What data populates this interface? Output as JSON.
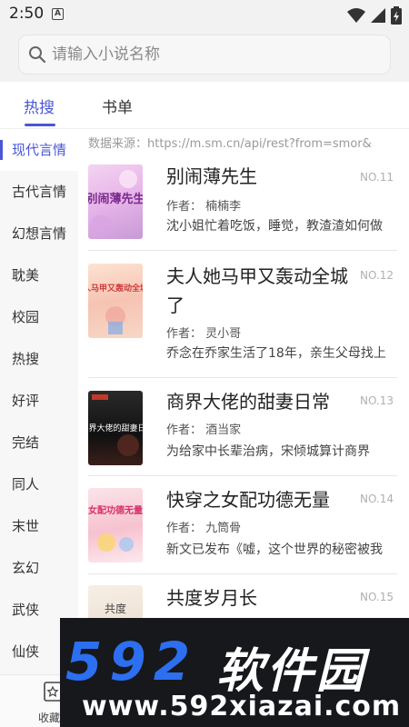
{
  "status_bar": {
    "time": "2:50",
    "notification_letter": "A"
  },
  "search": {
    "placeholder": "请输入小说名称",
    "value": ""
  },
  "tabs": [
    {
      "label": "热搜",
      "active": true
    },
    {
      "label": "书单",
      "active": false
    }
  ],
  "sidebar": {
    "items": [
      {
        "label": "现代言情",
        "active": true
      },
      {
        "label": "古代言情"
      },
      {
        "label": "幻想言情"
      },
      {
        "label": "耽美"
      },
      {
        "label": "校园"
      },
      {
        "label": "热搜"
      },
      {
        "label": "好评"
      },
      {
        "label": "完结"
      },
      {
        "label": "同人"
      },
      {
        "label": "末世"
      },
      {
        "label": "玄幻"
      },
      {
        "label": "武侠"
      },
      {
        "label": "仙侠"
      }
    ]
  },
  "source_line": "数据来源：https://m.sm.cn/api/rest?from=smor&",
  "books": [
    {
      "title": "别闹薄先生",
      "no": "NO.11",
      "author": "作者：  楠楠李",
      "desc": "沈小姐忙着吃饭，睡觉，教渣渣如何做",
      "cover_text": "别闹薄先生"
    },
    {
      "title": "夫人她马甲又轰动全城了",
      "no": "NO.12",
      "author": "作者：  灵小哥",
      "desc": "乔念在乔家生活了18年，亲生父母找上",
      "cover_text": "夫人马甲又轰动全城了"
    },
    {
      "title": "商界大佬的甜妻日常",
      "no": "NO.13",
      "author": "作者：  酒当家",
      "desc": "  为给家中长辈治病，宋倾城算计商界",
      "cover_text": "商界大佬的甜妻日常"
    },
    {
      "title": "快穿之女配功德无量",
      "no": "NO.14",
      "author": "作者：  九筒骨",
      "desc": "新文已发布《嘘，这个世界的秘密被我",
      "cover_text": "女配功德无量"
    },
    {
      "title": "共度岁月长",
      "no": "NO.15",
      "author": "",
      "desc": "",
      "cover_text": "共度"
    }
  ],
  "bottom_nav": {
    "fav_label": "收藏"
  },
  "watermark": {
    "logo": "592",
    "logo_cn": "软件园",
    "url": "www.592xiazai.com"
  },
  "colors": {
    "accent": "#4a56d6",
    "watermark_blue": "#2c6ff0"
  }
}
